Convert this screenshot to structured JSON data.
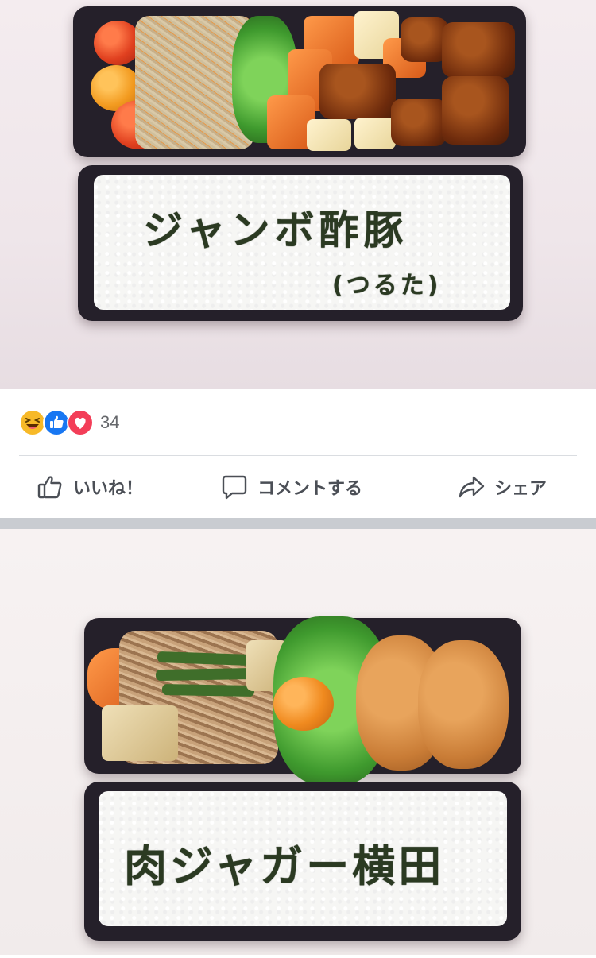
{
  "post1": {
    "photo": {
      "rice_text": "ジャンボ酢豚",
      "rice_subtext": "(つるた)"
    },
    "reactions": {
      "icons": [
        "laugh-emoji-icon",
        "like-thumb-icon",
        "love-heart-icon"
      ],
      "count": "34"
    },
    "actions": {
      "like_label": "いいね！",
      "comment_label": "コメントする",
      "share_label": "シェア"
    }
  },
  "post2": {
    "photo": {
      "rice_text": "肉ジャガー横田"
    }
  },
  "colors": {
    "like_blue": "#1877f2",
    "love_red": "#f33e58",
    "laugh_yellow": "#f7b928",
    "action_gray": "#4b4f56",
    "separator": "#c9ccd1"
  }
}
